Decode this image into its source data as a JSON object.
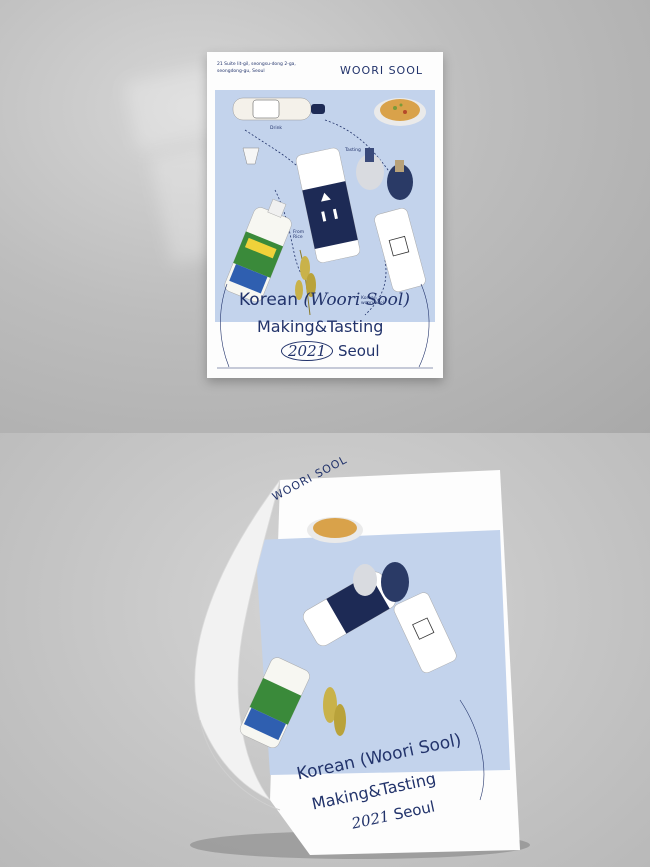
{
  "poster": {
    "address_line1": "21 Suite  lit-gil, seongsu-dong 2-ga,",
    "address_line2": "seongdong-gu, Seoul",
    "brand": "WOORI SOOL",
    "label_drink": "Drink",
    "label_tasting": "Tasting",
    "label_from_rice": "From Rice",
    "label_korean_woori_sool": "Korean woori sool",
    "title_line1_a": "Korean",
    "title_line1_b": "(Woori Sool)",
    "title_line2": "Making&Tasting",
    "title_year": "2021",
    "title_city": "Seoul"
  },
  "curled_poster": {
    "brand": "WOORI SOOL",
    "title_line1": "Korean (Woori Sool)",
    "title_line2": "Making&Tasting",
    "title_year": "2021",
    "title_city": "Seoul"
  },
  "colors": {
    "ink": "#22336b",
    "panel": "#c3d3ec",
    "paper": "#fdfdfd",
    "wall": "#bdbdbd",
    "floor": "#c8c8c8"
  }
}
